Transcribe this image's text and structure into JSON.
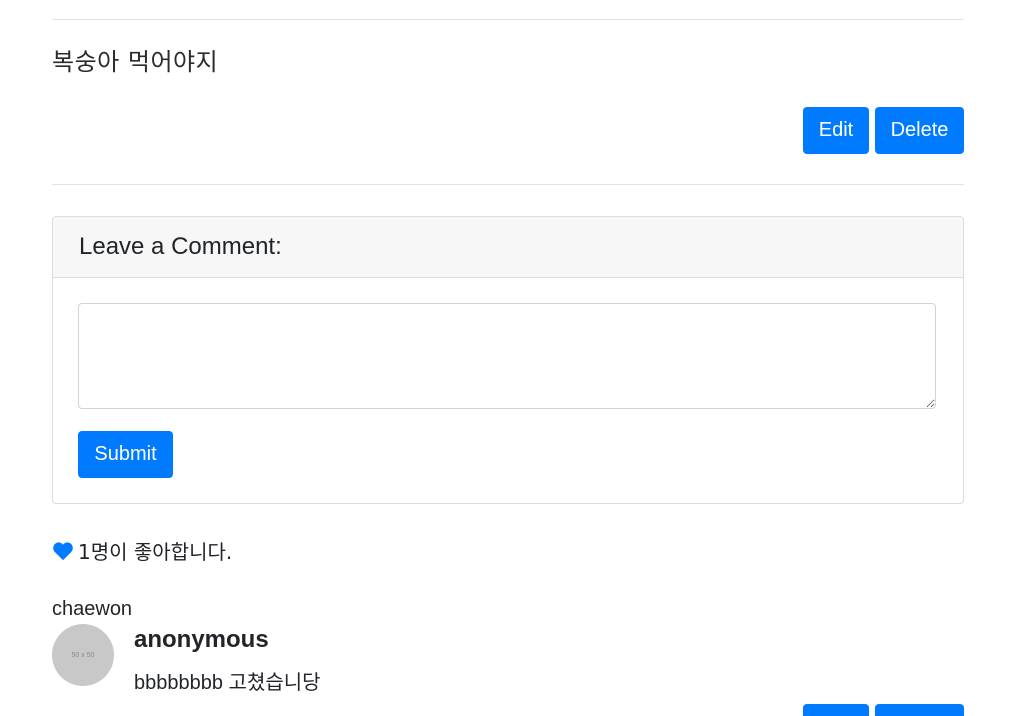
{
  "post": {
    "content": "복숭아 먹어야지",
    "edit_label": "Edit",
    "delete_label": "Delete"
  },
  "comment_form": {
    "title": "Leave a Comment:",
    "textarea_value": "",
    "submit_label": "Submit"
  },
  "likes": {
    "icon": "heart-icon",
    "text": "1명이 좋아합니다.",
    "color": "#007bff"
  },
  "comments": [
    {
      "author": "chaewon",
      "avatar_text": "50 x 50",
      "name": "anonymous",
      "text": "bbbbbbbb 고쳤습니당"
    }
  ],
  "colors": {
    "primary": "#007bff",
    "card_header": "#f7f7f7",
    "avatar_bg": "#c8c8c8"
  }
}
